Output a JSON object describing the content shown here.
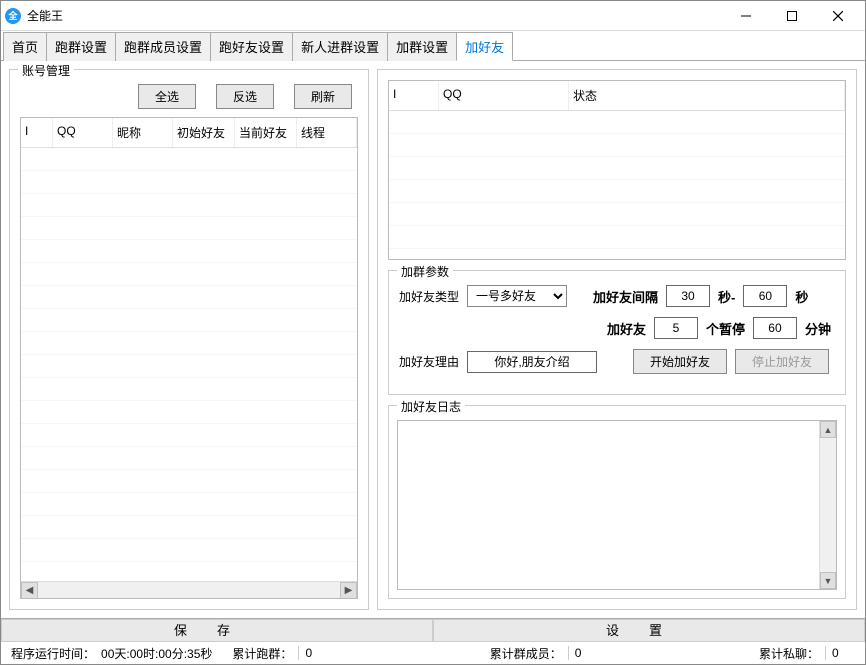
{
  "window": {
    "title": "全能王"
  },
  "tabs": [
    "首页",
    "跑群设置",
    "跑群成员设置",
    "跑好友设置",
    "新人进群设置",
    "加群设置",
    "加好友"
  ],
  "active_tab_index": 6,
  "left_panel": {
    "title": "账号管理",
    "buttons": {
      "select_all": "全选",
      "invert": "反选",
      "refresh": "刷新"
    },
    "columns": [
      "I",
      "QQ",
      "昵称",
      "初始好友",
      "当前好友",
      "线程"
    ]
  },
  "right_panel": {
    "top_columns": [
      "I",
      "QQ",
      "状态"
    ],
    "params_group": "加群参数",
    "type_label": "加好友类型",
    "type_options": [
      "一号多好友"
    ],
    "type_value": "一号多好友",
    "interval_label": "加好友间隔",
    "interval_low": "30",
    "interval_sep": "秒-",
    "interval_high": "60",
    "interval_unit": "秒",
    "count_label": "加好友",
    "count_value": "5",
    "count_mid": "个暂停",
    "pause_value": "60",
    "pause_unit": "分钟",
    "reason_label": "加好友理由",
    "reason_value": "你好,朋友介绍",
    "start_btn": "开始加好友",
    "stop_btn": "停止加好友",
    "log_group": "加好友日志"
  },
  "bottombar": {
    "save": "保存",
    "settings": "设置"
  },
  "status": {
    "runtime_label": "程序运行时间：",
    "runtime_value": "00天:00时:00分:35秒",
    "groups_label": "累计跑群：",
    "groups_value": "0",
    "members_label": "累计群成员：",
    "members_value": "0",
    "pm_label": "累计私聊：",
    "pm_value": "0"
  }
}
